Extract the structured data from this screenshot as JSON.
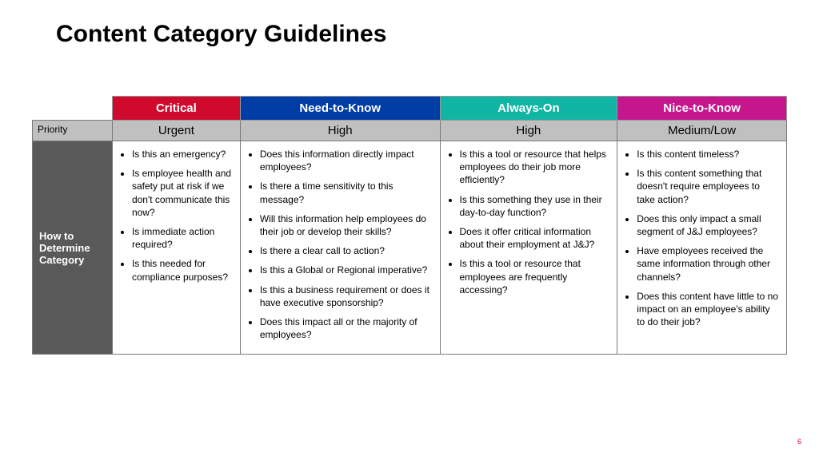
{
  "title": "Content Category Guidelines",
  "page_number": "6",
  "side": {
    "priority_label": "Priority",
    "determine_label": "How to Determine Category"
  },
  "categories": [
    {
      "name": "Critical",
      "priority": "Urgent",
      "questions": [
        "Is this an emergency?",
        "Is employee health and safety put at risk if we don't communicate this now?",
        "Is immediate action required?",
        "Is this needed for compliance purposes?"
      ]
    },
    {
      "name": "Need-to-Know",
      "priority": "High",
      "questions": [
        "Does this information directly impact employees?",
        "Is there a time sensitivity to this message?",
        "Will this information help employees do their job or develop their skills?",
        "Is there a clear call to action?",
        "Is this a Global or Regional imperative?",
        "Is this a business requirement or does it have executive sponsorship?",
        "Does this impact all or the majority of employees?"
      ]
    },
    {
      "name": "Always-On",
      "priority": "High",
      "questions": [
        "Is this a tool or resource that helps employees do their job more efficiently?",
        "Is this something they use in their day-to-day function?",
        "Does it offer critical information about their employment at J&J?",
        "Is this a tool or resource that employees are frequently accessing?"
      ]
    },
    {
      "name": "Nice-to-Know",
      "priority": "Medium/Low",
      "questions": [
        "Is this content timeless?",
        "Is this content something that doesn't require employees to take action?",
        "Does this only impact a small segment of J&J employees?",
        "Have employees received the same information through other channels?",
        "Does this content have little to no impact on an employee's ability to do their job?"
      ]
    }
  ]
}
